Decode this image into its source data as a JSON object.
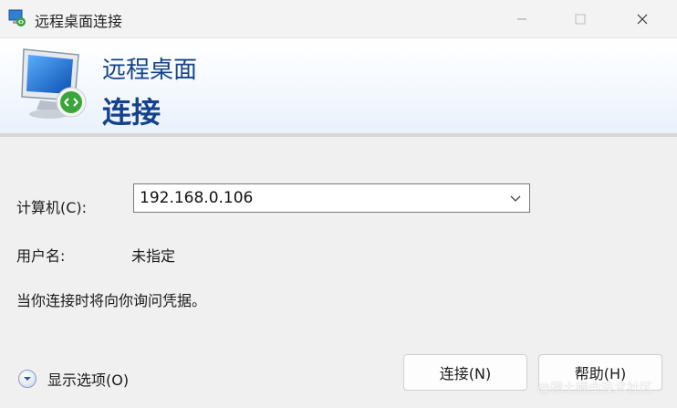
{
  "window": {
    "title": "远程桌面连接",
    "controls": {
      "minimize": "minimize-icon",
      "maximize": "maximize-icon",
      "close": "close-icon"
    }
  },
  "banner": {
    "line1": "远程桌面",
    "line2": "连接",
    "icon": "remote-desktop-monitor-icon"
  },
  "form": {
    "computer_label": "计算机(C):",
    "computer_value": "192.168.0.106",
    "user_label": "用户名:",
    "user_value": "未指定",
    "notice": "当你连接时将向你询问凭据。"
  },
  "footer": {
    "options_label": "显示选项(O)",
    "connect_label": "连接(N)",
    "help_label": "帮助(H)"
  },
  "watermark": "@稀土掘金技术社区",
  "colors": {
    "banner_text": "#15428b",
    "accent": "#1e6fd9"
  }
}
